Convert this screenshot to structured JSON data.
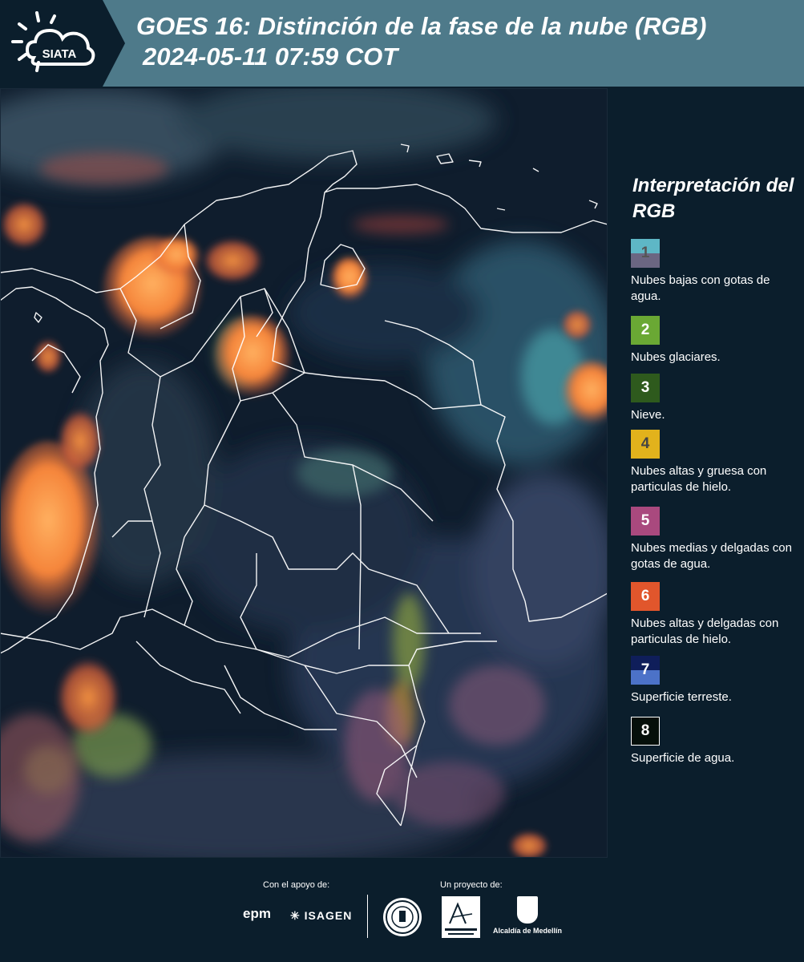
{
  "header": {
    "logo_text": "SIATA",
    "title_line1": "GOES 16: Distinción de la fase de la nube (RGB)",
    "title_line2": "2024-05-11 07:59 COT",
    "background_color": "#4e7a8a"
  },
  "legend": {
    "title": "Interpretación del RGB",
    "items": [
      {
        "number": "1",
        "label": "Nubes bajas con gotas de agua.",
        "color_top": "#5eb7c6",
        "color_bottom": "#6b6682",
        "text_color": "#555555"
      },
      {
        "number": "2",
        "label": "Nubes glaciares.",
        "color_top": "#6aa834",
        "text_color": "#ffffff"
      },
      {
        "number": "3",
        "label": "Nieve.",
        "color_top": "#2e5a1d",
        "text_color": "#ffffff"
      },
      {
        "number": "4",
        "label": "Nubes altas y gruesa con particulas de hielo.",
        "color_top": "#e2b21c",
        "text_color": "#444444"
      },
      {
        "number": "5",
        "label": "Nubes medias y delgadas con gotas de agua.",
        "color_top": "#a9497e",
        "text_color": "#ffffff"
      },
      {
        "number": "6",
        "label": "Nubes altas y delgadas con particulas de hielo.",
        "color_top": "#e1562c",
        "text_color": "#ffffff"
      },
      {
        "number": "7",
        "label": "Superficie terreste.",
        "color_top": "#0f1e5a",
        "color_bottom": "#4c72c8",
        "text_color": "#ffffff"
      },
      {
        "number": "8",
        "label": "Superficie de agua.",
        "color_top": "#050f0a",
        "text_color": "#ffffff",
        "border": "#ffffff"
      }
    ]
  },
  "footer": {
    "support_label": "Con el apoyo de:",
    "project_label": "Un proyecto de:",
    "sponsor_1": "epm",
    "sponsor_2": "ISAGEN",
    "partner_3": "Alcaldía de Medellín"
  }
}
